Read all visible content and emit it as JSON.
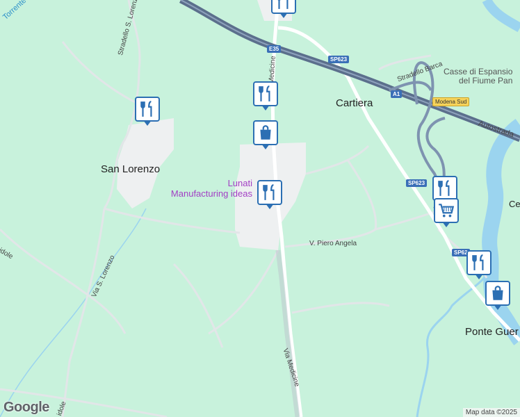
{
  "map": {
    "places": {
      "san_lorenzo": "San Lorenzo",
      "cartiera": "Cartiera",
      "ponte_guerro": "Ponte Guer",
      "ce": "Ce"
    },
    "poi": {
      "lunati_line1": "Lunati",
      "lunati_line2": "Manufacturing ideas"
    },
    "areas": {
      "casse_line1": "Casse di Espansio",
      "casse_line2": "del Fiume Pan"
    },
    "roads": {
      "via_medicine_top": "Medicine",
      "via_medicine": "Via Medicine",
      "v_piero_angela": "V. Piero Angela",
      "stradello_s_lorenzo": "Stradello S. Lorenz",
      "via_s_lorenzo": "Via S. Lorenzo",
      "stradello_barca": "Stradello Barca",
      "autostrada": "Autostrada",
      "road_left_1": "idole",
      "road_left_2": "idole"
    },
    "water": {
      "torrente": "Torrente Tie"
    },
    "shields": {
      "e35": "E35",
      "sp623_1": "SP623",
      "a1": "A1",
      "modena_sud": "Modena Sud",
      "sp623_2": "SP623",
      "sp62": "SP62"
    },
    "markers": [
      {
        "name": "restaurant-marker-san-lorenzo",
        "icon": "restaurant-icon"
      },
      {
        "name": "restaurant-marker-medicine",
        "icon": "restaurant-icon"
      },
      {
        "name": "shopping-marker-medicine",
        "icon": "shopping-bag-icon"
      },
      {
        "name": "restaurant-marker-lunati",
        "icon": "restaurant-icon"
      },
      {
        "name": "restaurant-marker-top",
        "icon": "restaurant-icon"
      },
      {
        "name": "restaurant-marker-sp623",
        "icon": "restaurant-icon"
      },
      {
        "name": "grocery-marker-sp623",
        "icon": "shopping-cart-icon"
      },
      {
        "name": "restaurant-marker-ponte",
        "icon": "restaurant-icon"
      },
      {
        "name": "shopping-marker-ponte",
        "icon": "shopping-bag-icon"
      }
    ],
    "attribution": "Map data ©2025",
    "logo": "Google",
    "colors": {
      "land": "#c8f2dc",
      "urban": "#eef0f1",
      "water": "#9bd4ef",
      "highway": "#5b6f8c",
      "marker_border": "#2c6fb3",
      "poi_text": "#a23fc4"
    }
  }
}
